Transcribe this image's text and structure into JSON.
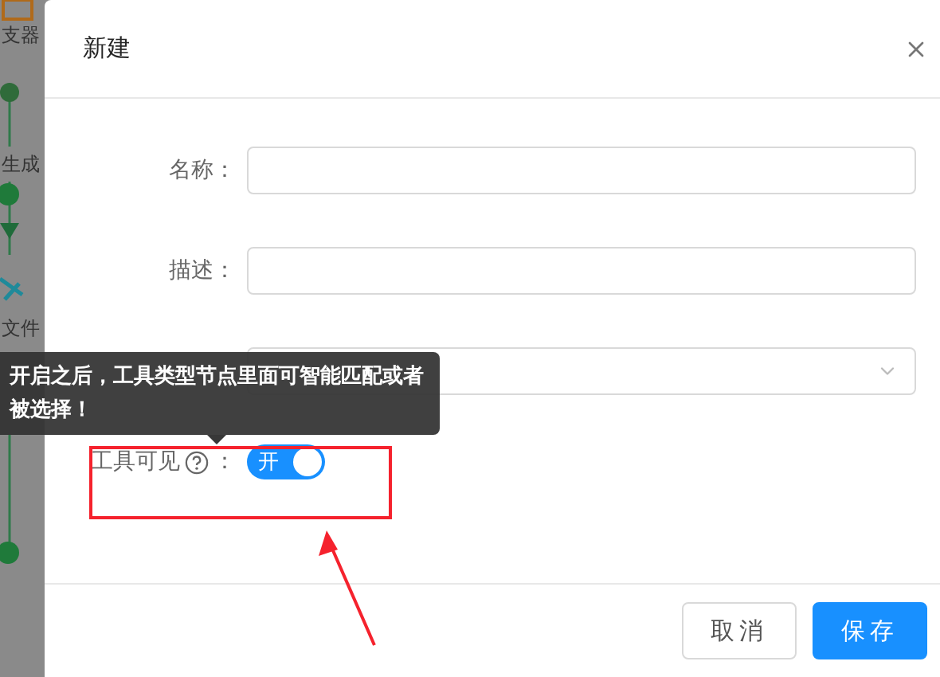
{
  "background": {
    "nodes": [
      {
        "label": "支器"
      },
      {
        "label": "生成"
      },
      {
        "label": "文件"
      }
    ]
  },
  "dialog": {
    "title": "新建",
    "fields": [
      {
        "kind": "input",
        "label": "名称："
      },
      {
        "kind": "input",
        "label": "描述："
      },
      {
        "kind": "select"
      },
      {
        "kind": "switch",
        "label": "工具可见",
        "colon": "：",
        "on": true,
        "switch_text": "开"
      }
    ],
    "tooltip": "开启之后，工具类型节点里面可智能匹配或者被选择！",
    "buttons": [
      {
        "label": "取消",
        "primary": false
      },
      {
        "label": "保存",
        "primary": true
      }
    ]
  }
}
